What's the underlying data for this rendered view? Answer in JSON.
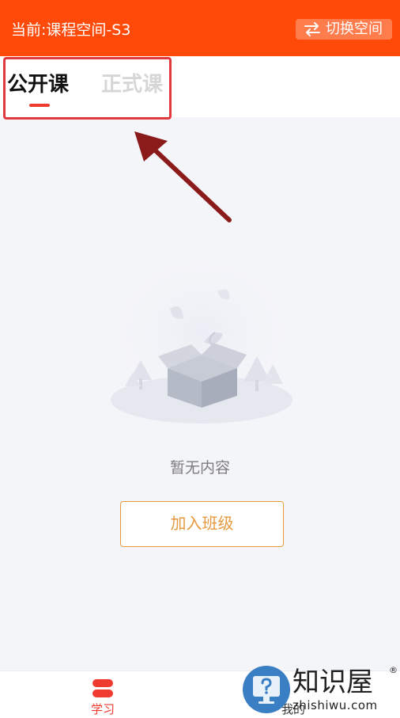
{
  "header": {
    "space_title": "当前:课程空间-S3",
    "switch_label": "切换空间",
    "background_color": "#ff4a09"
  },
  "tabs": [
    {
      "label": "公开课",
      "active": true
    },
    {
      "label": "正式课",
      "active": false
    }
  ],
  "empty_state": {
    "icon": "empty-box-icon",
    "message": "暂无内容",
    "join_button_label": "加入班级"
  },
  "bottom_nav": {
    "items": [
      {
        "label": "学习",
        "icon": "study-icon",
        "active": true
      },
      {
        "label": "我的",
        "icon": "profile-icon",
        "active": false
      }
    ]
  },
  "watermark": {
    "brand": "知识屋",
    "registered_mark": "®",
    "domain": "zhishiwu.com"
  },
  "colors": {
    "accent": "#ef3b2f",
    "join_button": "#e8993e",
    "annotation": "#e0383c",
    "arrow": "#8b1a1a"
  }
}
